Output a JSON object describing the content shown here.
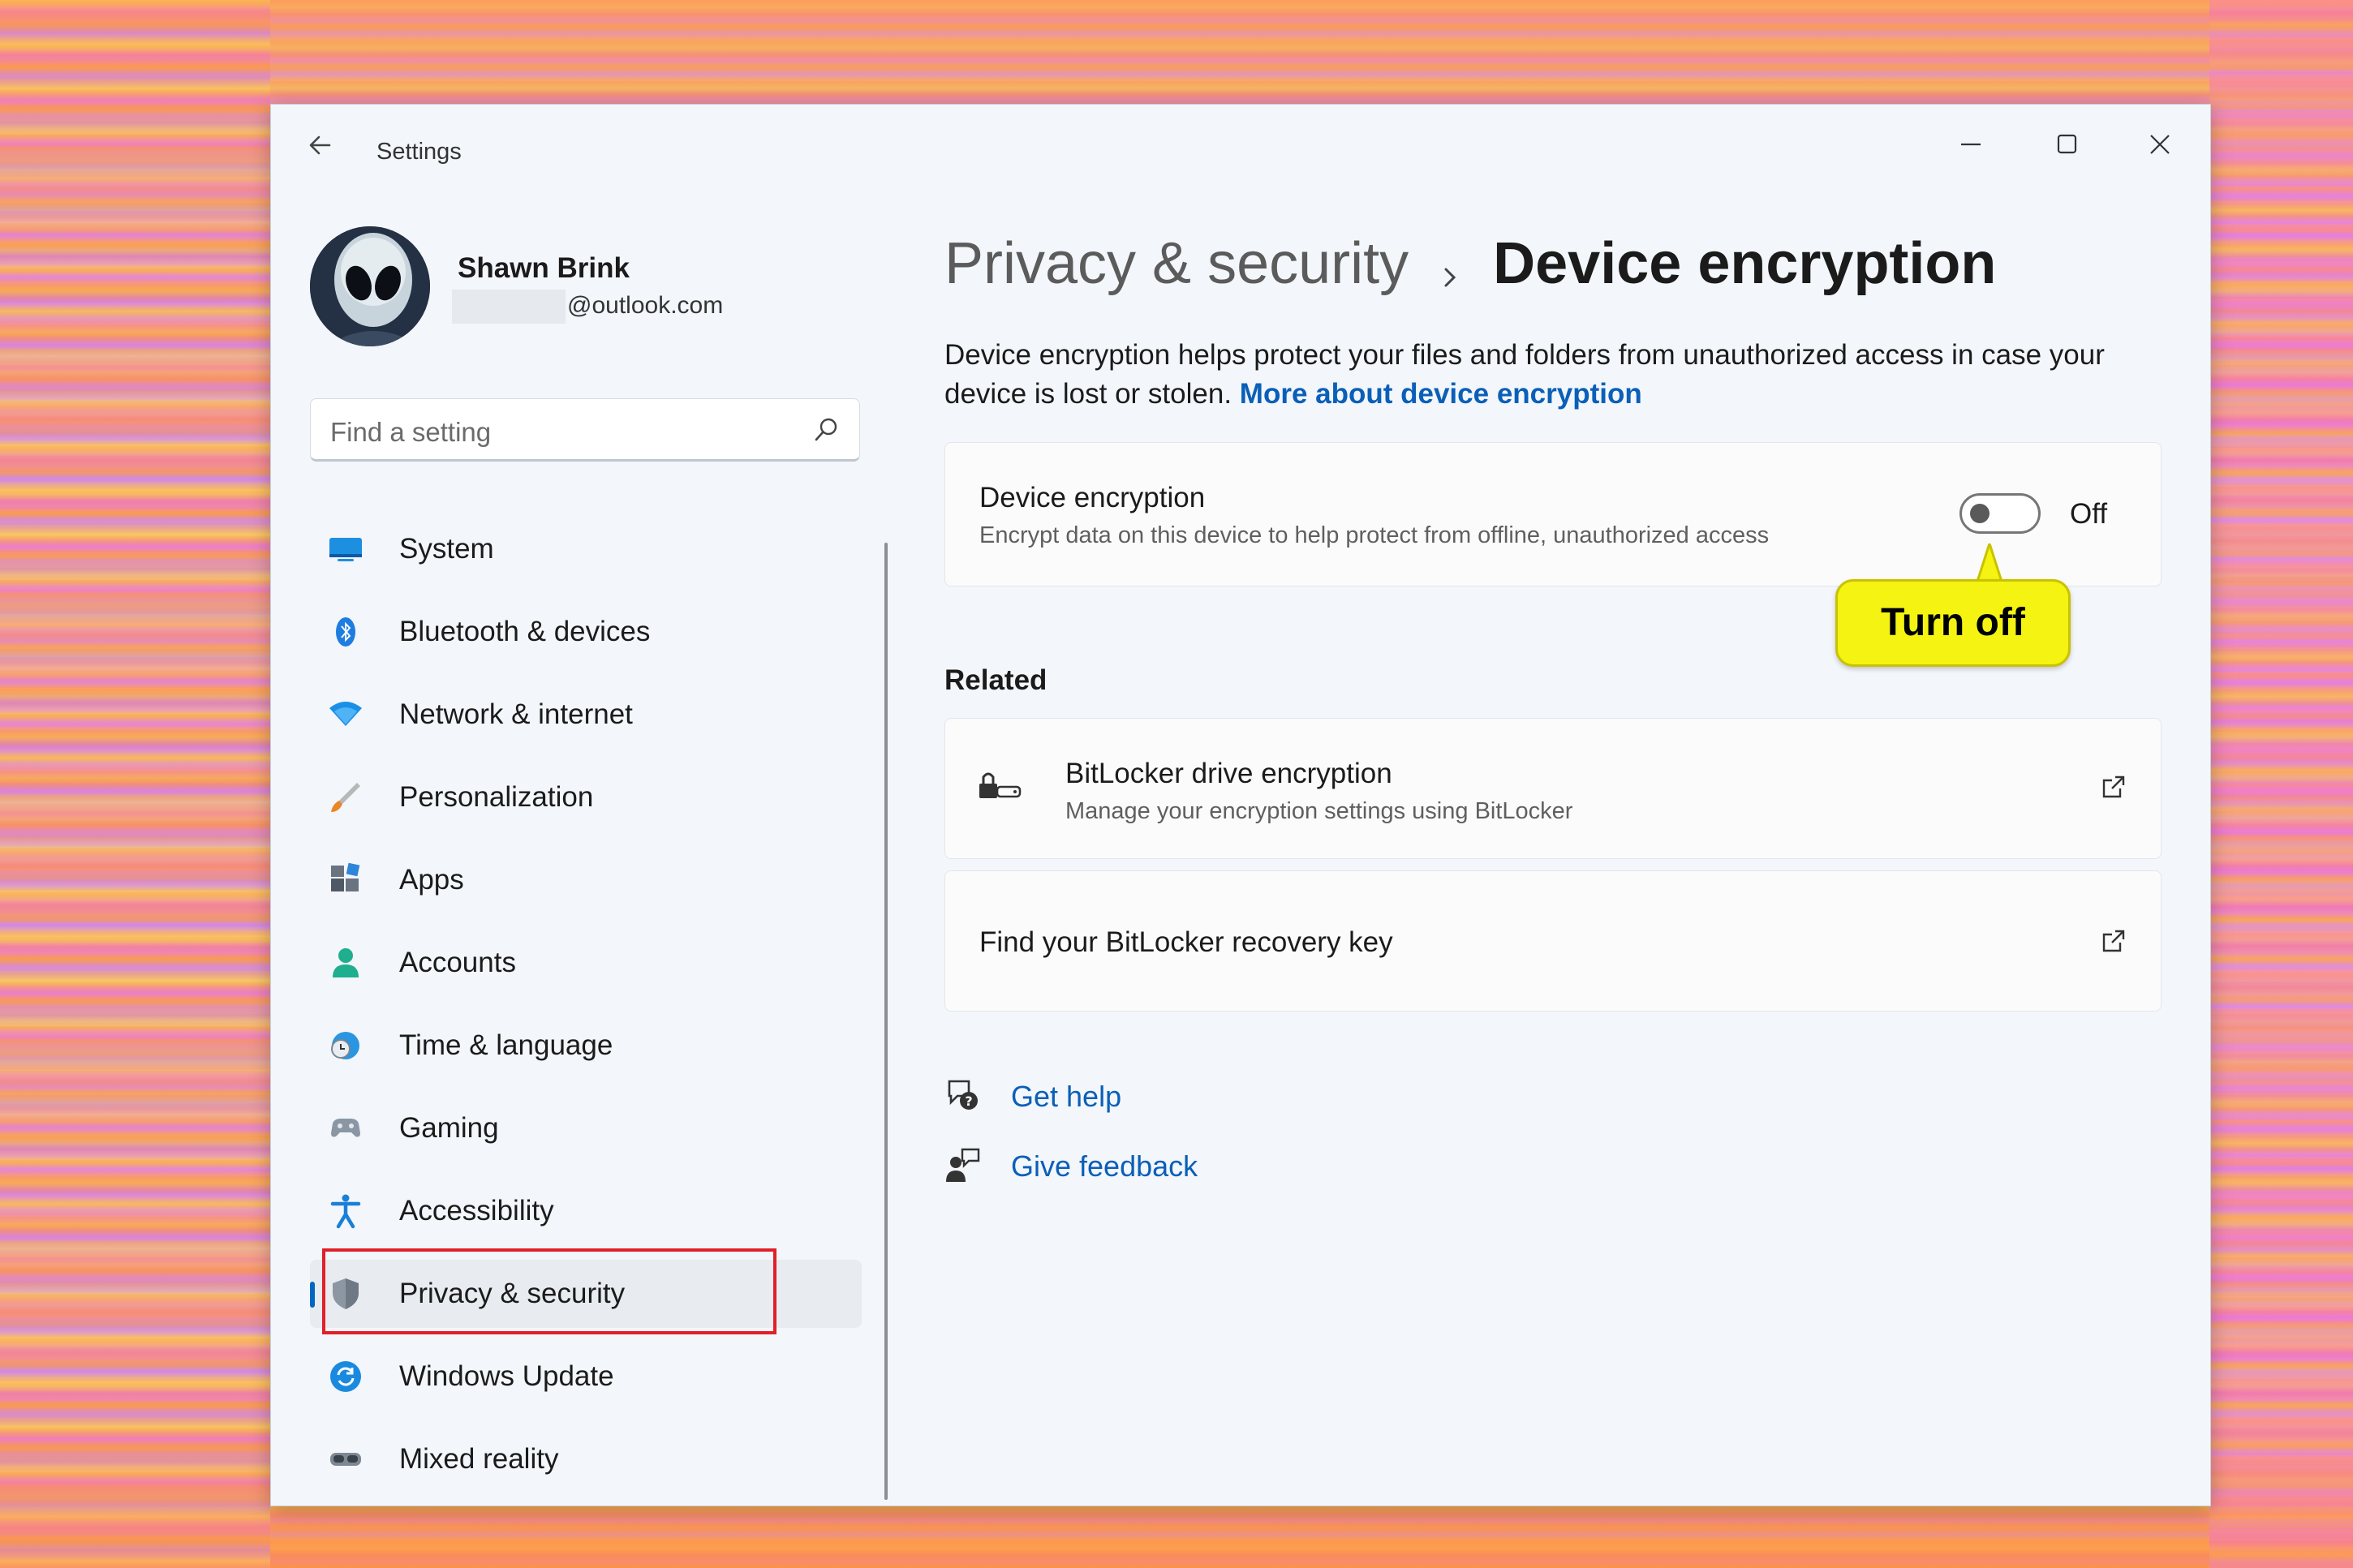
{
  "window": {
    "title": "Settings"
  },
  "profile": {
    "name": "Shawn Brink",
    "email_visible": "@outlook.com"
  },
  "search": {
    "placeholder": "Find a setting"
  },
  "nav": {
    "items": [
      {
        "label": "System",
        "icon": "system-icon"
      },
      {
        "label": "Bluetooth & devices",
        "icon": "bluetooth-icon"
      },
      {
        "label": "Network & internet",
        "icon": "wifi-icon"
      },
      {
        "label": "Personalization",
        "icon": "brush-icon"
      },
      {
        "label": "Apps",
        "icon": "apps-icon"
      },
      {
        "label": "Accounts",
        "icon": "person-icon"
      },
      {
        "label": "Time & language",
        "icon": "globe-clock-icon"
      },
      {
        "label": "Gaming",
        "icon": "gamepad-icon"
      },
      {
        "label": "Accessibility",
        "icon": "accessibility-icon"
      },
      {
        "label": "Privacy & security",
        "icon": "shield-icon",
        "selected": true
      },
      {
        "label": "Windows Update",
        "icon": "update-icon"
      },
      {
        "label": "Mixed reality",
        "icon": "headset-icon"
      }
    ]
  },
  "breadcrumb": {
    "parent": "Privacy & security",
    "current": "Device encryption"
  },
  "description": {
    "text": "Device encryption helps protect your files and folders from unauthorized access in case your device is lost or stolen.",
    "link": "More about device encryption"
  },
  "encryption_card": {
    "title": "Device encryption",
    "subtitle": "Encrypt data on this device to help protect from offline, unauthorized access",
    "toggle_state": "Off",
    "toggle_on": false
  },
  "callout": {
    "text": "Turn off"
  },
  "related": {
    "heading": "Related",
    "items": [
      {
        "title": "BitLocker drive encryption",
        "subtitle": "Manage your encryption settings using BitLocker",
        "icon": "bitlocker-icon"
      },
      {
        "title": "Find your BitLocker recovery key"
      }
    ]
  },
  "help": {
    "get_help": "Get help",
    "give_feedback": "Give feedback"
  },
  "colors": {
    "accent": "#0067c0",
    "link": "#0a5fb8",
    "highlight_box": "#e0202a",
    "callout": "#f4f312"
  }
}
